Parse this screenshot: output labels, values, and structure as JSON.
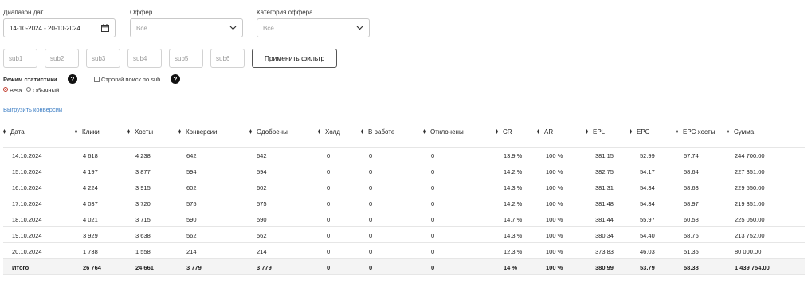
{
  "filters": {
    "date_label": "Диапазон дат",
    "date_value": "14-10-2024 - 20-10-2024",
    "offer_label": "Оффер",
    "offer_value": "Все",
    "category_label": "Категория оффера",
    "category_value": "Все",
    "subs": [
      "sub1",
      "sub2",
      "sub3",
      "sub4",
      "sub5",
      "sub6"
    ],
    "apply_label": "Применить фильтр"
  },
  "stats_mode": {
    "label": "Режим статистики",
    "help": "?",
    "strict_label": "Строгий поиск по sub",
    "options": [
      "Beta",
      "Обычный"
    ],
    "selected": "Beta"
  },
  "export_label": "Выгрузить конверсии",
  "table": {
    "columns": [
      "Дата",
      "Клики",
      "Хосты",
      "Конверсии",
      "Одобрены",
      "Холд",
      "В работе",
      "Отклонены",
      "CR",
      "AR",
      "EPL",
      "EPC",
      "EPC хосты",
      "Сумма"
    ],
    "rows": [
      [
        "14.10.2024",
        "4 618",
        "4 238",
        "642",
        "642",
        "0",
        "0",
        "0",
        "13.9 %",
        "100 %",
        "381.15",
        "52.99",
        "57.74",
        "244 700.00"
      ],
      [
        "15.10.2024",
        "4 197",
        "3 877",
        "594",
        "594",
        "0",
        "0",
        "0",
        "14.2 %",
        "100 %",
        "382.75",
        "54.17",
        "58.64",
        "227 351.00"
      ],
      [
        "16.10.2024",
        "4 224",
        "3 915",
        "602",
        "602",
        "0",
        "0",
        "0",
        "14.3 %",
        "100 %",
        "381.31",
        "54.34",
        "58.63",
        "229 550.00"
      ],
      [
        "17.10.2024",
        "4 037",
        "3 720",
        "575",
        "575",
        "0",
        "0",
        "0",
        "14.2 %",
        "100 %",
        "381.48",
        "54.34",
        "58.97",
        "219 351.00"
      ],
      [
        "18.10.2024",
        "4 021",
        "3 715",
        "590",
        "590",
        "0",
        "0",
        "0",
        "14.7 %",
        "100 %",
        "381.44",
        "55.97",
        "60.58",
        "225 050.00"
      ],
      [
        "19.10.2024",
        "3 929",
        "3 638",
        "562",
        "562",
        "0",
        "0",
        "0",
        "14.3 %",
        "100 %",
        "380.34",
        "54.40",
        "58.76",
        "213 752.00"
      ],
      [
        "20.10.2024",
        "1 738",
        "1 558",
        "214",
        "214",
        "0",
        "0",
        "0",
        "12.3 %",
        "100 %",
        "373.83",
        "46.03",
        "51.35",
        "80 000.00"
      ]
    ],
    "total": [
      "Итого",
      "26 764",
      "24 661",
      "3 779",
      "3 779",
      "0",
      "0",
      "0",
      "14 %",
      "100 %",
      "380.99",
      "53.79",
      "58.38",
      "1 439 754.00"
    ]
  },
  "colors": {
    "link": "#3b7dc4",
    "radio_selected": "#c0392b",
    "total_row_bg": "#f4f4f4"
  }
}
